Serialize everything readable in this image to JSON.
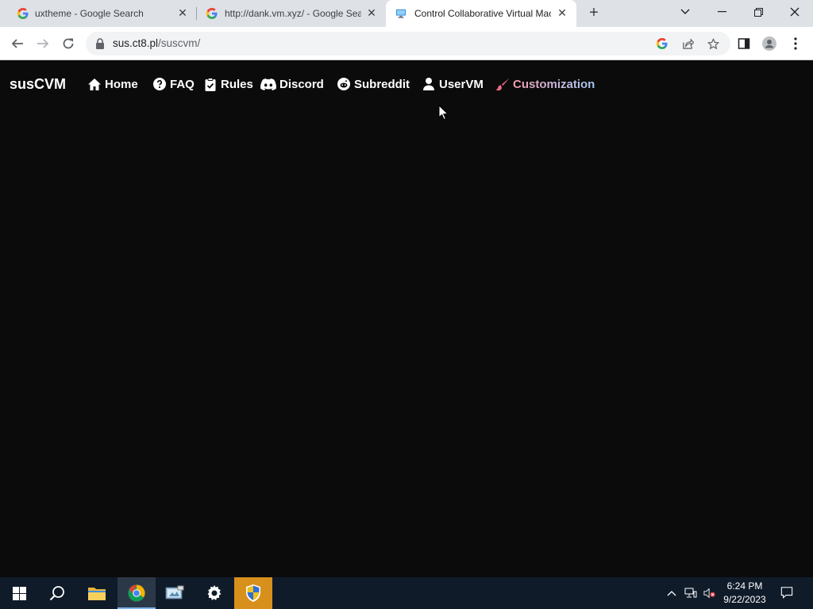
{
  "browser": {
    "tabs": [
      {
        "title": "uxtheme - Google Search",
        "favicon": "google-g-icon"
      },
      {
        "title": "http://dank.vm.xyz/ - Google Search",
        "favicon": "google-g-icon"
      },
      {
        "title": "Control Collaborative Virtual Machines",
        "favicon": "monitor-icon",
        "active": true
      }
    ],
    "url_host": "sus.ct8.pl",
    "url_path": "/suscvm/"
  },
  "site": {
    "brand": "susCVM",
    "nav": [
      {
        "label": "Home",
        "icon": "home-icon"
      },
      {
        "label": "FAQ",
        "icon": "question-circle-icon"
      },
      {
        "label": "Rules",
        "icon": "clipboard-check-icon"
      },
      {
        "label": "Discord",
        "icon": "discord-icon"
      },
      {
        "label": "Subreddit",
        "icon": "reddit-icon"
      },
      {
        "label": "UserVM",
        "icon": "user-icon"
      },
      {
        "label": "Customization",
        "icon": "paintbrush-icon"
      }
    ],
    "customization_color": "#f06a8a"
  },
  "taskbar": {
    "time": "6:24 PM",
    "date": "9/22/2023"
  }
}
